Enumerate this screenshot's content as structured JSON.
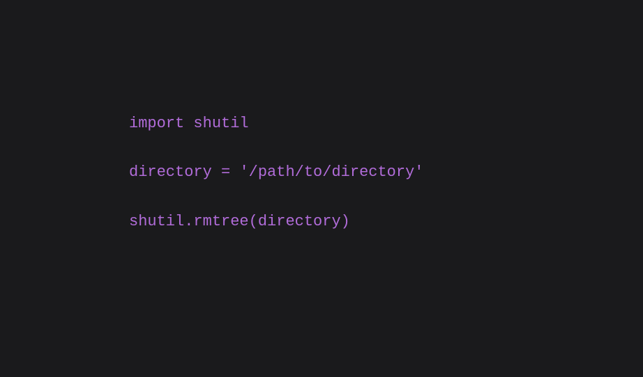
{
  "code": {
    "line1": {
      "keyword": "import",
      "module": "shutil"
    },
    "line3": {
      "varname": "directory",
      "assign": "=",
      "string": "'/path/to/directory'"
    },
    "line5": {
      "module": "shutil",
      "dot": ".",
      "func": "rmtree",
      "open": "(",
      "arg": "directory",
      "close": ")"
    }
  }
}
